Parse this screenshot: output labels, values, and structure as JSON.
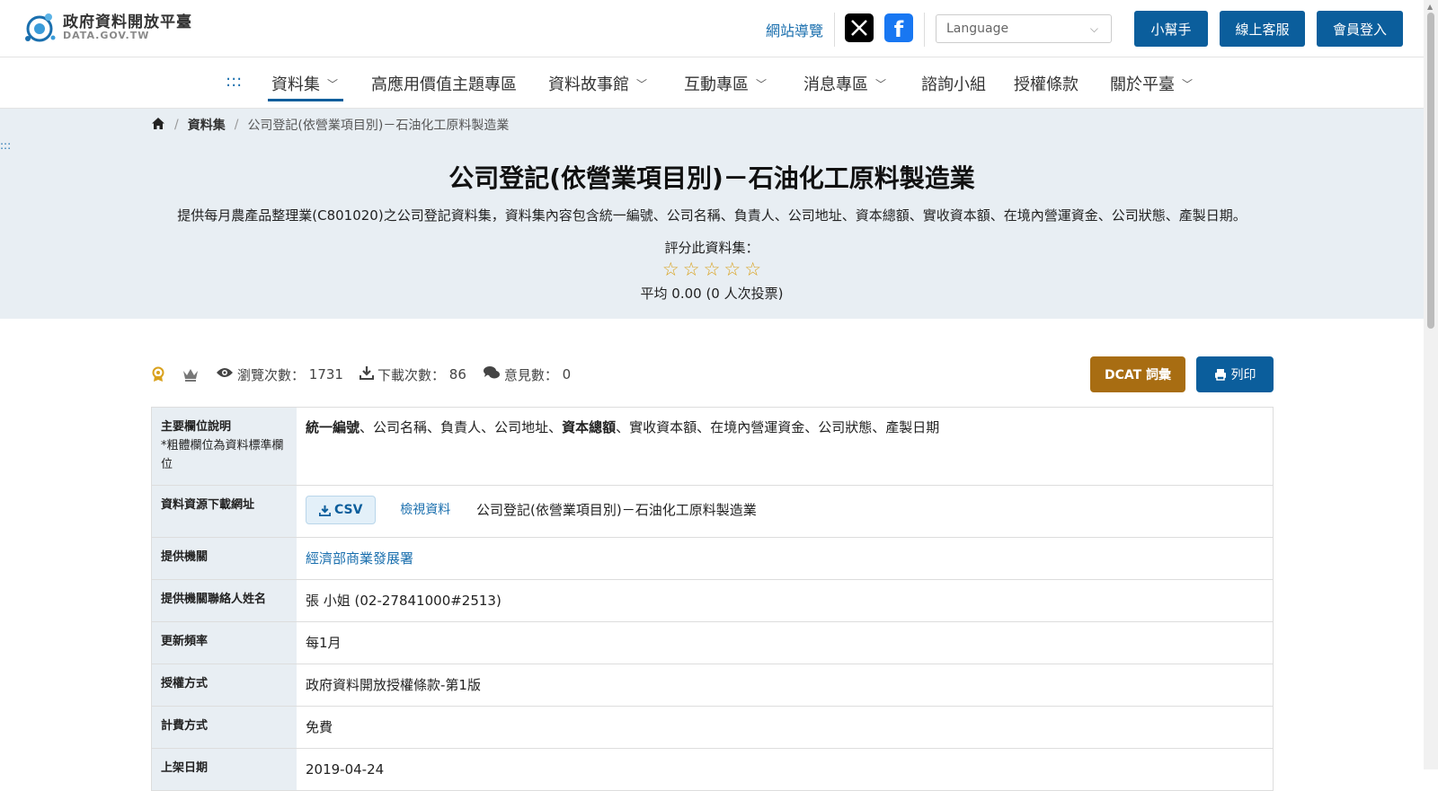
{
  "header": {
    "logo_title": "政府資料開放平臺",
    "logo_sub": "DATA.GOV.TW",
    "site_map": "網站導覽",
    "social": {
      "x_icon": "x-icon",
      "fb_icon": "facebook-icon"
    },
    "language_placeholder": "Language",
    "helper_btn": "小幫手",
    "service_btn": "線上客服",
    "login_btn": "會員登入"
  },
  "nav": {
    "menu_dots": ":::",
    "items": [
      {
        "label": "資料集",
        "has_dropdown": true,
        "active": true
      },
      {
        "label": "高應用價值主題專區",
        "has_dropdown": false
      },
      {
        "label": "資料故事館",
        "has_dropdown": true
      },
      {
        "label": "互動專區",
        "has_dropdown": true
      },
      {
        "label": "消息專區",
        "has_dropdown": true
      },
      {
        "label": "諮詢小組",
        "has_dropdown": false
      },
      {
        "label": "授權條款",
        "has_dropdown": false
      },
      {
        "label": "關於平臺",
        "has_dropdown": true
      }
    ]
  },
  "breadcrumb": {
    "home_icon": "home-icon",
    "link": "資料集",
    "current": "公司登記(依營業項目別)－石油化工原料製造業"
  },
  "skip_marker": ":::",
  "hero": {
    "title": "公司登記(依營業項目別)－石油化工原料製造業",
    "description": "提供每月農產品整理業(C801020)之公司登記資料集，資料集內容包含統一編號、公司名稱、負責人、公司地址、資本總額、實收資本額、在境內營運資金、公司狀態、產製日期。",
    "rate_label": "評分此資料集：",
    "stars_total": 5,
    "stars_filled": 0,
    "avg_text": "平均 0.00 (0 人次投票)"
  },
  "stats": {
    "views_label": "瀏覽次數：",
    "views": "1731",
    "downloads_label": "下載次數：",
    "downloads": "86",
    "comments_label": "意見數：",
    "comments": "0",
    "dcat_btn": "DCAT 詞彙",
    "print_btn": "列印"
  },
  "info": {
    "fields_label": "主要欄位說明",
    "fields_note": "*粗體欄位為資料標準欄位",
    "fields": [
      {
        "text": "統一編號",
        "bold": true
      },
      {
        "text": "公司名稱",
        "bold": false
      },
      {
        "text": "負責人",
        "bold": false
      },
      {
        "text": "公司地址",
        "bold": false
      },
      {
        "text": "資本總額",
        "bold": true
      },
      {
        "text": "實收資本額",
        "bold": false
      },
      {
        "text": "在境內營運資金",
        "bold": false
      },
      {
        "text": "公司狀態",
        "bold": false
      },
      {
        "text": "產製日期",
        "bold": false
      }
    ],
    "resource_label": "資料資源下載網址",
    "csv_btn": "CSV",
    "view_link": "檢視資料",
    "resource_name": "公司登記(依營業項目別)－石油化工原料製造業",
    "agency_label": "提供機關",
    "agency": "經濟部商業發展署",
    "contact_label": "提供機關聯絡人姓名",
    "contact": "張 小姐 (02-27841000#2513)",
    "frequency_label": "更新頻率",
    "frequency": "每1月",
    "license_label": "授權方式",
    "license": "政府資料開放授權條款-第1版",
    "fee_label": "計費方式",
    "fee": "免費",
    "date_label": "上架日期",
    "date": "2019-04-24"
  },
  "colors": {
    "primary": "#0b5e9c",
    "dcat": "#a86d12",
    "hero_bg": "#e8eef3",
    "star": "#d9a11c",
    "link": "#1a6fae"
  }
}
